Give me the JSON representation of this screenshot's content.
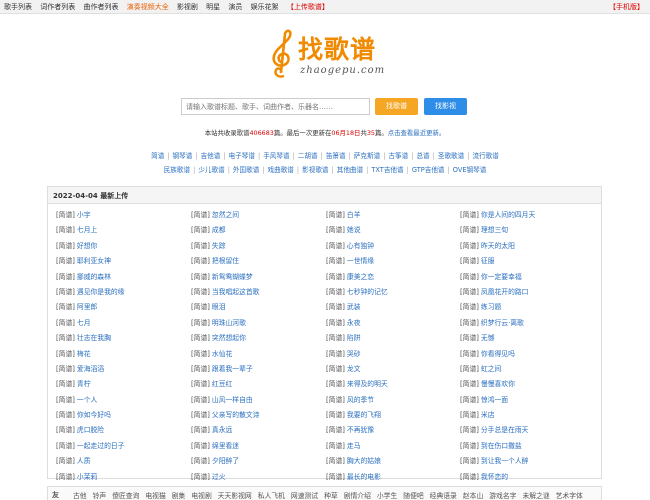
{
  "topnav": {
    "items": [
      {
        "label": "歌手列表"
      },
      {
        "label": "词作者列表"
      },
      {
        "label": "曲作者列表"
      },
      {
        "label": "演奏视频大全"
      },
      {
        "label": "影视剧"
      },
      {
        "label": "明星"
      },
      {
        "label": "演员"
      },
      {
        "label": "娱乐花絮"
      },
      {
        "label": "【上传歌谱】"
      }
    ],
    "mobile": "【手机版】"
  },
  "logo": {
    "brand": "找歌谱",
    "domain": "zhaogepu.com"
  },
  "search": {
    "placeholder": "请输入歌谱标题、歌手、词曲作者、乐器名……",
    "btn_score": "找歌谱",
    "btn_video": "找影视"
  },
  "stats": {
    "p1": "本站共收录歌谱",
    "count": "406683",
    "p2": "篇。最后一次更新在",
    "date": "06月18日",
    "p3": "共",
    "updated": "35",
    "p4": "篇。",
    "link": "点击查看最近更新。"
  },
  "categories": {
    "row1": [
      "简谱",
      "钢琴谱",
      "吉他谱",
      "电子琴谱",
      "手风琴谱",
      "二胡谱",
      "笛箫谱",
      "萨克斯谱",
      "古筝谱",
      "总谱",
      "圣歌歌谱",
      "流行歌谱"
    ],
    "row2": [
      "民族歌谱",
      "少儿歌谱",
      "外国歌谱",
      "戏曲歌谱",
      "影视歌谱",
      "其他曲谱",
      "TXT吉他谱",
      "GTP吉他谱",
      "OVE钢琴谱"
    ]
  },
  "panel": {
    "title": "2022-04-04 最新上传",
    "tag": "[简谱]",
    "columns": [
      [
        "小宇",
        "七月上",
        "好想你",
        "耶利亚女神",
        "挪威的森林",
        "遇见你是我的缘",
        "阿里郎",
        "七月",
        "壮志在我胸",
        "梅花",
        "爱海滔滔",
        "青柠",
        "一个人",
        "你如今好吗",
        "虎口脱险",
        "一起走过的日子",
        "人质",
        "小茉莉"
      ],
      [
        "忽然之间",
        "成都",
        "失踪",
        "把根留住",
        "新鸳鸯蝴蝶梦",
        "当我唱起这首歌",
        "眼泪",
        "明珠山河歌",
        "突然想起你",
        "水仙花",
        "跟着我一辈子",
        "红豆红",
        "山风一样自由",
        "父亲写的散文诗",
        "真永远",
        "绵里看迷",
        "夕阳醉了",
        "过火"
      ],
      [
        "白羊",
        "她说",
        "心有独钟",
        "一世情缘",
        "康美之恋",
        "七秒钟的记忆",
        "武装",
        "永夜",
        "陷阱",
        "哭砂",
        "龙文",
        "来得及的明天",
        "风的季节",
        "我要的飞翔",
        "不再犹豫",
        "走马",
        "胸大的姑娘",
        "最长的电影"
      ],
      [
        "你是人间的四月天",
        "理想三旬",
        "昨天的太阳",
        "征服",
        "你一定要幸福",
        "凤凰花开的路口",
        "练习题",
        "织梦行云·离歌",
        "无憾",
        "你看得见吗",
        "虹之间",
        "慢慢喜欢你",
        "惊鸿一面",
        "米店",
        "分手总是在雨天",
        "到在伤口撒盐",
        "到让我一个人醉",
        "我怀恋的"
      ]
    ]
  },
  "links": {
    "label": "友",
    "items": [
      "古他",
      "铃声",
      "傻匠查询",
      "电视猫",
      "剧集",
      "电视剧",
      "天天影视网",
      "私人飞机",
      "网速测试",
      "种草",
      "剧情介绍",
      "小学生",
      "随便吧",
      "经典语录",
      "赵本山",
      "游戏名字",
      "未解之谜",
      "艺术字体"
    ]
  },
  "colors": {
    "accent_orange": "#f08a00",
    "link_blue": "#2a6fbf",
    "highlight_red": "#d00000",
    "search_orange": "#f5a623",
    "search_blue": "#2e8de6"
  }
}
